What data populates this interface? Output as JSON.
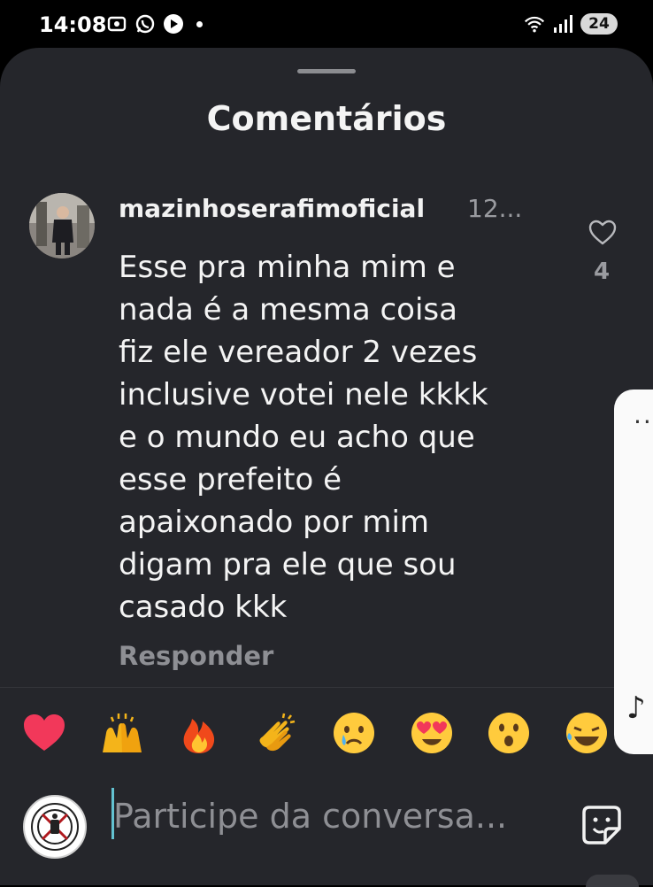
{
  "status_bar": {
    "time": "14:08",
    "battery": "24",
    "icons": [
      "screenshot-icon",
      "whatsapp-icon",
      "play-icon",
      "notification-dot",
      "wifi-icon",
      "signal-icon",
      "battery-icon"
    ]
  },
  "sheet": {
    "title": "Comentários"
  },
  "comment": {
    "username": "mazinhoserafimoficial",
    "time": "12...",
    "text": "Esse pra minha mim e\nnada é a mesma coisa\nfiz ele vereador 2 vezes\ninclusive votei nele kkkk\ne o mundo eu acho que\nesse prefeito é\napaixonado por mim\ndigam pra ele que sou\ncasado kkk",
    "reply_label": "Responder",
    "like_count": "4"
  },
  "reactions": [
    "heart",
    "raising-hands",
    "fire",
    "clapping-hands",
    "crying-face",
    "heart-eyes",
    "surprised-face",
    "laughing-face"
  ],
  "composer": {
    "placeholder": "Participe da conversa..."
  },
  "colors": {
    "sheet_bg": "#25262b",
    "secondary_text": "#8e8f94",
    "caret": "#63c2d1"
  }
}
